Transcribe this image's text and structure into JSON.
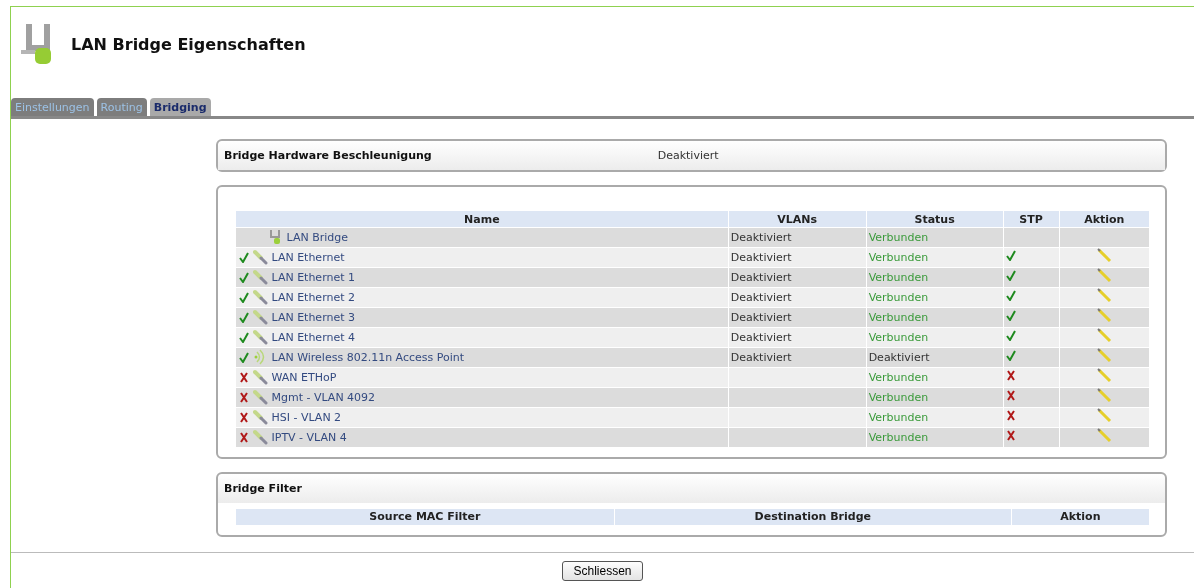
{
  "window": {
    "title": "LAN Bridge Eigenschaften"
  },
  "tabs": [
    {
      "label": "Einstellungen",
      "selected": false
    },
    {
      "label": "Routing",
      "selected": false
    },
    {
      "label": "Bridging",
      "selected": true
    }
  ],
  "hardware": {
    "label": "Bridge Hardware Beschleunigung",
    "value": "Deaktiviert"
  },
  "interfaces": {
    "columns": [
      "Name",
      "VLANs",
      "Status",
      "STP",
      "Aktion"
    ],
    "rows": [
      {
        "kind": "bridge",
        "name": "LAN Bridge",
        "vlans": "Deaktiviert",
        "status": "Verbunden",
        "connected": true,
        "editable": false
      },
      {
        "kind": "ethernet",
        "member": true,
        "name": "LAN Ethernet",
        "vlans": "Deaktiviert",
        "status": "Verbunden",
        "connected": true,
        "stp": true,
        "editable": true
      },
      {
        "kind": "ethernet",
        "member": true,
        "name": "LAN Ethernet 1",
        "vlans": "Deaktiviert",
        "status": "Verbunden",
        "connected": true,
        "stp": true,
        "editable": true
      },
      {
        "kind": "ethernet",
        "member": true,
        "name": "LAN Ethernet 2",
        "vlans": "Deaktiviert",
        "status": "Verbunden",
        "connected": true,
        "stp": true,
        "editable": true
      },
      {
        "kind": "ethernet",
        "member": true,
        "name": "LAN Ethernet 3",
        "vlans": "Deaktiviert",
        "status": "Verbunden",
        "connected": true,
        "stp": true,
        "editable": true
      },
      {
        "kind": "ethernet",
        "member": true,
        "name": "LAN Ethernet 4",
        "vlans": "Deaktiviert",
        "status": "Verbunden",
        "connected": true,
        "stp": true,
        "editable": true
      },
      {
        "kind": "wireless",
        "member": true,
        "name": "LAN Wireless 802.11n Access Point",
        "vlans": "Deaktiviert",
        "status": "Deaktiviert",
        "connected": false,
        "stp": true,
        "editable": true
      },
      {
        "kind": "ethernet",
        "member": false,
        "name": "WAN ETHoP",
        "status": "Verbunden",
        "connected": true,
        "stp": false,
        "editable": true
      },
      {
        "kind": "ethernet",
        "member": false,
        "name": "Mgmt - VLAN 4092",
        "status": "Verbunden",
        "connected": true,
        "stp": false,
        "editable": true
      },
      {
        "kind": "ethernet",
        "member": false,
        "name": "HSI - VLAN 2",
        "status": "Verbunden",
        "connected": true,
        "stp": false,
        "editable": true
      },
      {
        "kind": "ethernet",
        "member": false,
        "name": "IPTV - VLAN 4",
        "status": "Verbunden",
        "connected": true,
        "stp": false,
        "editable": true
      }
    ]
  },
  "filter": {
    "title": "Bridge Filter",
    "columns": [
      "Source MAC Filter",
      "Destination Bridge",
      "Aktion"
    ]
  },
  "buttons": [
    "Schliessen"
  ]
}
